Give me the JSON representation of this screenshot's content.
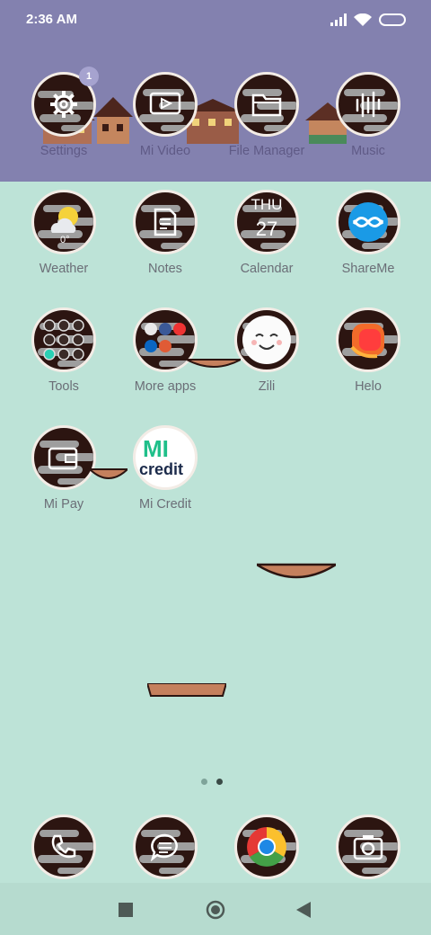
{
  "status_bar": {
    "time": "2:36 AM",
    "icons": [
      "signal-icon",
      "wifi-icon",
      "battery-icon"
    ]
  },
  "top_apps": [
    {
      "label": "Settings",
      "icon": "gear-icon",
      "badge": "1"
    },
    {
      "label": "Mi Video",
      "icon": "play-icon"
    },
    {
      "label": "File Manager",
      "icon": "folder-icon"
    },
    {
      "label": "Music",
      "icon": "music-icon"
    }
  ],
  "grid_apps": [
    {
      "label": "Weather",
      "icon": "weather-icon",
      "detail": "0°"
    },
    {
      "label": "Notes",
      "icon": "notes-icon"
    },
    {
      "label": "Calendar",
      "icon": "calendar-icon",
      "day": "THU",
      "date": "27"
    },
    {
      "label": "ShareMe",
      "icon": "shareme-icon"
    },
    {
      "label": "Tools",
      "icon": "tools-folder-icon"
    },
    {
      "label": "More apps",
      "icon": "apps-folder-icon"
    },
    {
      "label": "Zili",
      "icon": "zili-icon"
    },
    {
      "label": "Helo",
      "icon": "helo-icon"
    },
    {
      "label": "Mi Pay",
      "icon": "wallet-icon"
    },
    {
      "label": "Mi Credit",
      "icon": "mi-credit-icon",
      "logo_text": "MI",
      "logo_sub": "credit"
    }
  ],
  "dock_apps": [
    {
      "name": "Phone",
      "icon": "phone-icon"
    },
    {
      "name": "Messaging",
      "icon": "message-icon"
    },
    {
      "name": "Chrome",
      "icon": "chrome-icon"
    },
    {
      "name": "Camera",
      "icon": "camera-icon"
    }
  ],
  "page_indicator": {
    "pages": 2,
    "current": 2
  },
  "nav_bar": [
    "recents-button",
    "home-button",
    "back-button"
  ],
  "colors": {
    "top_band": "#8381af",
    "background": "#bde3d7",
    "icon_bg": "#2c1511",
    "cloud": "#9a9a9a",
    "label": "#6b6e77"
  }
}
